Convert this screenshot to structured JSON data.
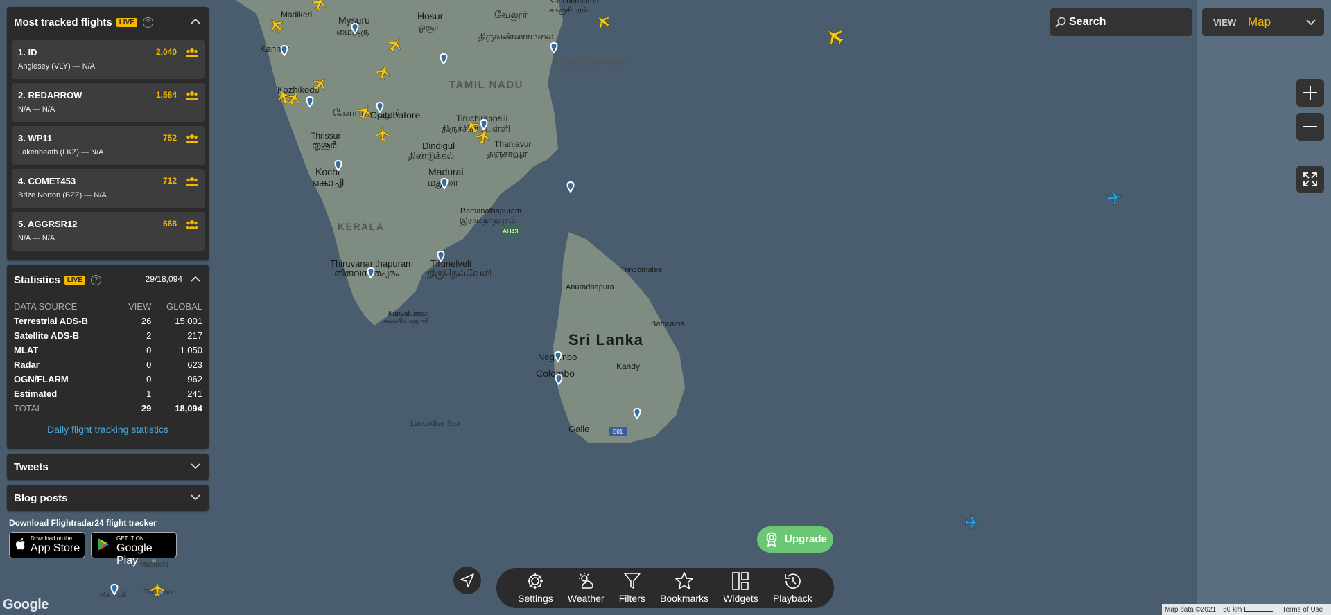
{
  "colors": {
    "panel_bg": "#2b2b2b",
    "accent": "#f5b800",
    "link": "#4ea8de",
    "upgrade": "#6cc775",
    "water": "#4a5d6e",
    "land": "#7f8c82"
  },
  "most_tracked": {
    "title": "Most tracked flights",
    "live_badge": "LIVE",
    "help_icon": "question-circle-icon",
    "flights": [
      {
        "name": "1. ID",
        "route": "Anglesey (VLY) — N/A",
        "count": "2,040"
      },
      {
        "name": "2. REDARROW",
        "route": "N/A — N/A",
        "count": "1,584"
      },
      {
        "name": "3. WP11",
        "route": "Lakenheath (LKZ) — N/A",
        "count": "752"
      },
      {
        "name": "4. COMET453",
        "route": "Brize Norton (BZZ) — N/A",
        "count": "712"
      },
      {
        "name": "5. AGGRSR12",
        "route": "N/A — N/A",
        "count": "668"
      }
    ]
  },
  "statistics": {
    "title": "Statistics",
    "live_badge": "LIVE",
    "summary": "29/18,094",
    "headers": [
      "DATA SOURCE",
      "VIEW",
      "GLOBAL"
    ],
    "rows": [
      {
        "source": "Terrestrial ADS-B",
        "view": "26",
        "global": "15,001"
      },
      {
        "source": "Satellite ADS-B",
        "view": "2",
        "global": "217"
      },
      {
        "source": "MLAT",
        "view": "0",
        "global": "1,050"
      },
      {
        "source": "Radar",
        "view": "0",
        "global": "623"
      },
      {
        "source": "OGN/FLARM",
        "view": "0",
        "global": "962"
      },
      {
        "source": "Estimated",
        "view": "1",
        "global": "241"
      }
    ],
    "total": {
      "source": "TOTAL",
      "view": "29",
      "global": "18,094"
    },
    "daily_link": "Daily flight tracking statistics"
  },
  "tweets": {
    "title": "Tweets"
  },
  "blog": {
    "title": "Blog posts"
  },
  "download": {
    "title": "Download Flightradar24 flight tracker",
    "appstore_small": "Download on the",
    "appstore_big": "App Store",
    "gplay_small": "GET IT ON",
    "gplay_big": "Google Play"
  },
  "search": {
    "label": "Search",
    "icon": "search-icon"
  },
  "view_selector": {
    "label": "VIEW",
    "value": "Map"
  },
  "upgrade": {
    "label": "Upgrade"
  },
  "bottom_bar": {
    "items": [
      {
        "label": "Settings",
        "icon": "gear-icon"
      },
      {
        "label": "Weather",
        "icon": "weather-icon"
      },
      {
        "label": "Filters",
        "icon": "filter-icon"
      },
      {
        "label": "Bookmarks",
        "icon": "star-icon"
      },
      {
        "label": "Widgets",
        "icon": "widgets-icon"
      },
      {
        "label": "Playback",
        "icon": "history-icon"
      }
    ]
  },
  "map": {
    "labels": {
      "madikeri": "Madikeri",
      "mysuru": "Mysuru",
      "mysuru_ta": "மைசூரு",
      "hosur": "Hosur",
      "hosur_ta": "ஓசூர்",
      "vellore": "வேலூர்",
      "tiruvannamalai": "திருவண்ணாமலை",
      "kancheepuram": "Kancheepuram",
      "kancheepuram_ta": "காஞ்சிபுரம்",
      "puducherry": "PUDUCHERRY",
      "tamil_nadu": "TAMIL NADU",
      "kannur": "Kannur",
      "kozhikode": "Kozhikode",
      "coimbatore": "Coimbatore",
      "coimbatore_ta": "கோயம்புத்தூர்",
      "tiruchirappalli": "Tiruchirappalli",
      "tiruchi_ta": "திருச்சிராப்பள்ளி",
      "thanjavur": "Thanjavur",
      "thanjavur_ta": "தஞ்சாவூர்",
      "thrissur": "Thrissur",
      "thrissur_ml": "തൃശൂർ",
      "dindigul": "Dindigul",
      "dindigul_ta": "திண்டுக்கல்",
      "kochi": "Kochi",
      "kochi_ml": "കൊച്ചി",
      "madurai": "Madurai",
      "madurai_ta": "மதுரை",
      "ramanathapuram": "Ramanathapuram",
      "ramanathapuram_ta": "இராமநாதபுரம்",
      "ah43": "AH43",
      "kerala": "KERALA",
      "thiruvananthapuram": "Thiruvananthapuram",
      "thiruvananthapuram_ml": "തിരുവനന്തപുരം",
      "tirunelveli": "Tirunelveli",
      "tirunelveli_ta": "திருநெல்வேலி",
      "kanyakumari": "Kanyakumari",
      "kanyakumari_ta": "கன்னியாகுமரி",
      "trincomalee": "Trincomalee",
      "anuradhapura": "Anuradhapura",
      "sri_lanka": "Sri Lanka",
      "batticaloa": "Batticaloa",
      "negombo": "Negombo",
      "colombo": "Colombo",
      "kandy": "Kandy",
      "galle": "Galle",
      "e01": "E01",
      "laccadive_sea": "Laccadive Sea",
      "maafushi": "Maafushi",
      "maafushi_left": "Ma",
      "maafushi_right": "gili",
      "thinadhoo": "Thi",
      "thinadhoo_r": "noo"
    },
    "attribution": "Map data ©2021",
    "scale": "50 km",
    "terms": "Terms of Use",
    "google": "Google"
  }
}
